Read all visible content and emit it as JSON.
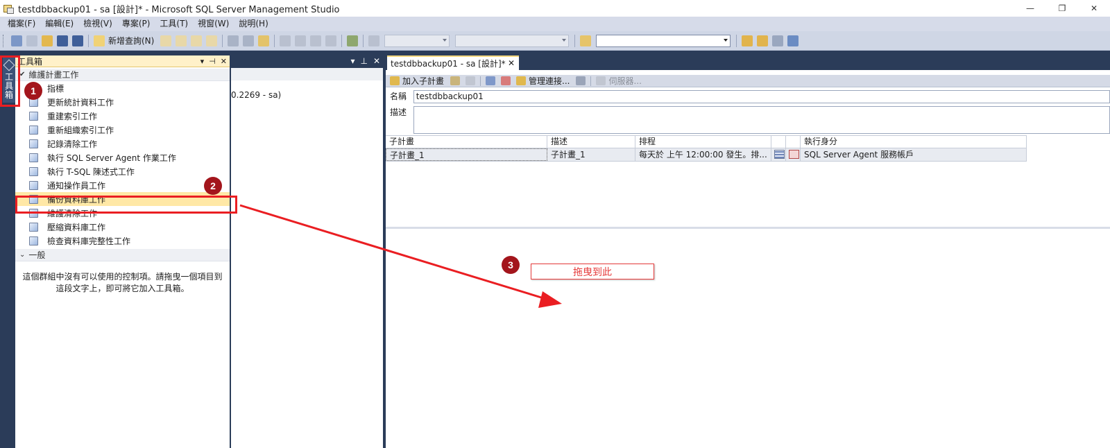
{
  "window": {
    "title": "testdbbackup01 - sa [設計]* - Microsoft SQL Server Management Studio",
    "minimize": "—",
    "restore": "❐",
    "close": "✕"
  },
  "menu": [
    "檔案(F)",
    "編輯(E)",
    "檢視(V)",
    "專案(P)",
    "工具(T)",
    "視窗(W)",
    "說明(H)"
  ],
  "toolbar": {
    "new_query_label": "新增查詢(N)"
  },
  "side_tab": {
    "label": [
      "工",
      "具",
      "箱"
    ]
  },
  "toolbox": {
    "title": "工具箱",
    "controls": [
      "▾",
      "⊣",
      "✕"
    ],
    "group_maintenance": "維護計畫工作",
    "items": [
      {
        "label": "指標",
        "icon": "pointer-icon"
      },
      {
        "label": "更新統計資料工作",
        "icon": "update-statistics-icon"
      },
      {
        "label": "重建索引工作",
        "icon": "rebuild-index-icon"
      },
      {
        "label": "重新組織索引工作",
        "icon": "reorganize-index-icon"
      },
      {
        "label": "記錄清除工作",
        "icon": "history-cleanup-icon"
      },
      {
        "label": "執行 SQL Server Agent 作業工作",
        "icon": "agent-job-icon"
      },
      {
        "label": "執行 T-SQL 陳述式工作",
        "icon": "tsql-icon"
      },
      {
        "label": "通知操作員工作",
        "icon": "notify-operator-icon"
      },
      {
        "label": "備份資料庫工作",
        "icon": "backup-database-icon"
      },
      {
        "label": "維護清除工作",
        "icon": "maintenance-cleanup-icon"
      },
      {
        "label": "壓縮資料庫工作",
        "icon": "shrink-database-icon"
      },
      {
        "label": "檢查資料庫完整性工作",
        "icon": "check-integrity-icon"
      }
    ],
    "group_general": "一般",
    "empty_message": "這個群組中沒有可以使用的控制項。請拖曳一個項目到這段文字上，即可將它加入工具箱。"
  },
  "mid_pane": {
    "controls": [
      "▾",
      "⊥",
      "✕"
    ],
    "server_text": "0.2269 - sa)"
  },
  "document": {
    "tab_label": "testdbbackup01 - sa [設計]*",
    "tab_close": "✕",
    "design_toolbar": {
      "add_subplan": "加入子計畫",
      "manage_connections": "管理連接...",
      "servers": "伺服器..."
    },
    "name_label": "名稱",
    "name_value": "testdbbackup01",
    "desc_label": "描述",
    "desc_value": "",
    "grid": {
      "headers": [
        "子計畫",
        "描述",
        "排程",
        "",
        "",
        "執行身分"
      ],
      "row": {
        "subplan": "子計畫_1",
        "description": "子計畫_1",
        "schedule": "每天於 上午 12:00:00 發生。排...",
        "run_as": "SQL Server Agent 服務帳戶"
      }
    }
  },
  "annotations": {
    "badge1": "1",
    "badge2": "2",
    "badge3": "3",
    "drop_label": "拖曳到此",
    "highlight_color": "#ea1e22",
    "badge_color": "#a3151c"
  }
}
